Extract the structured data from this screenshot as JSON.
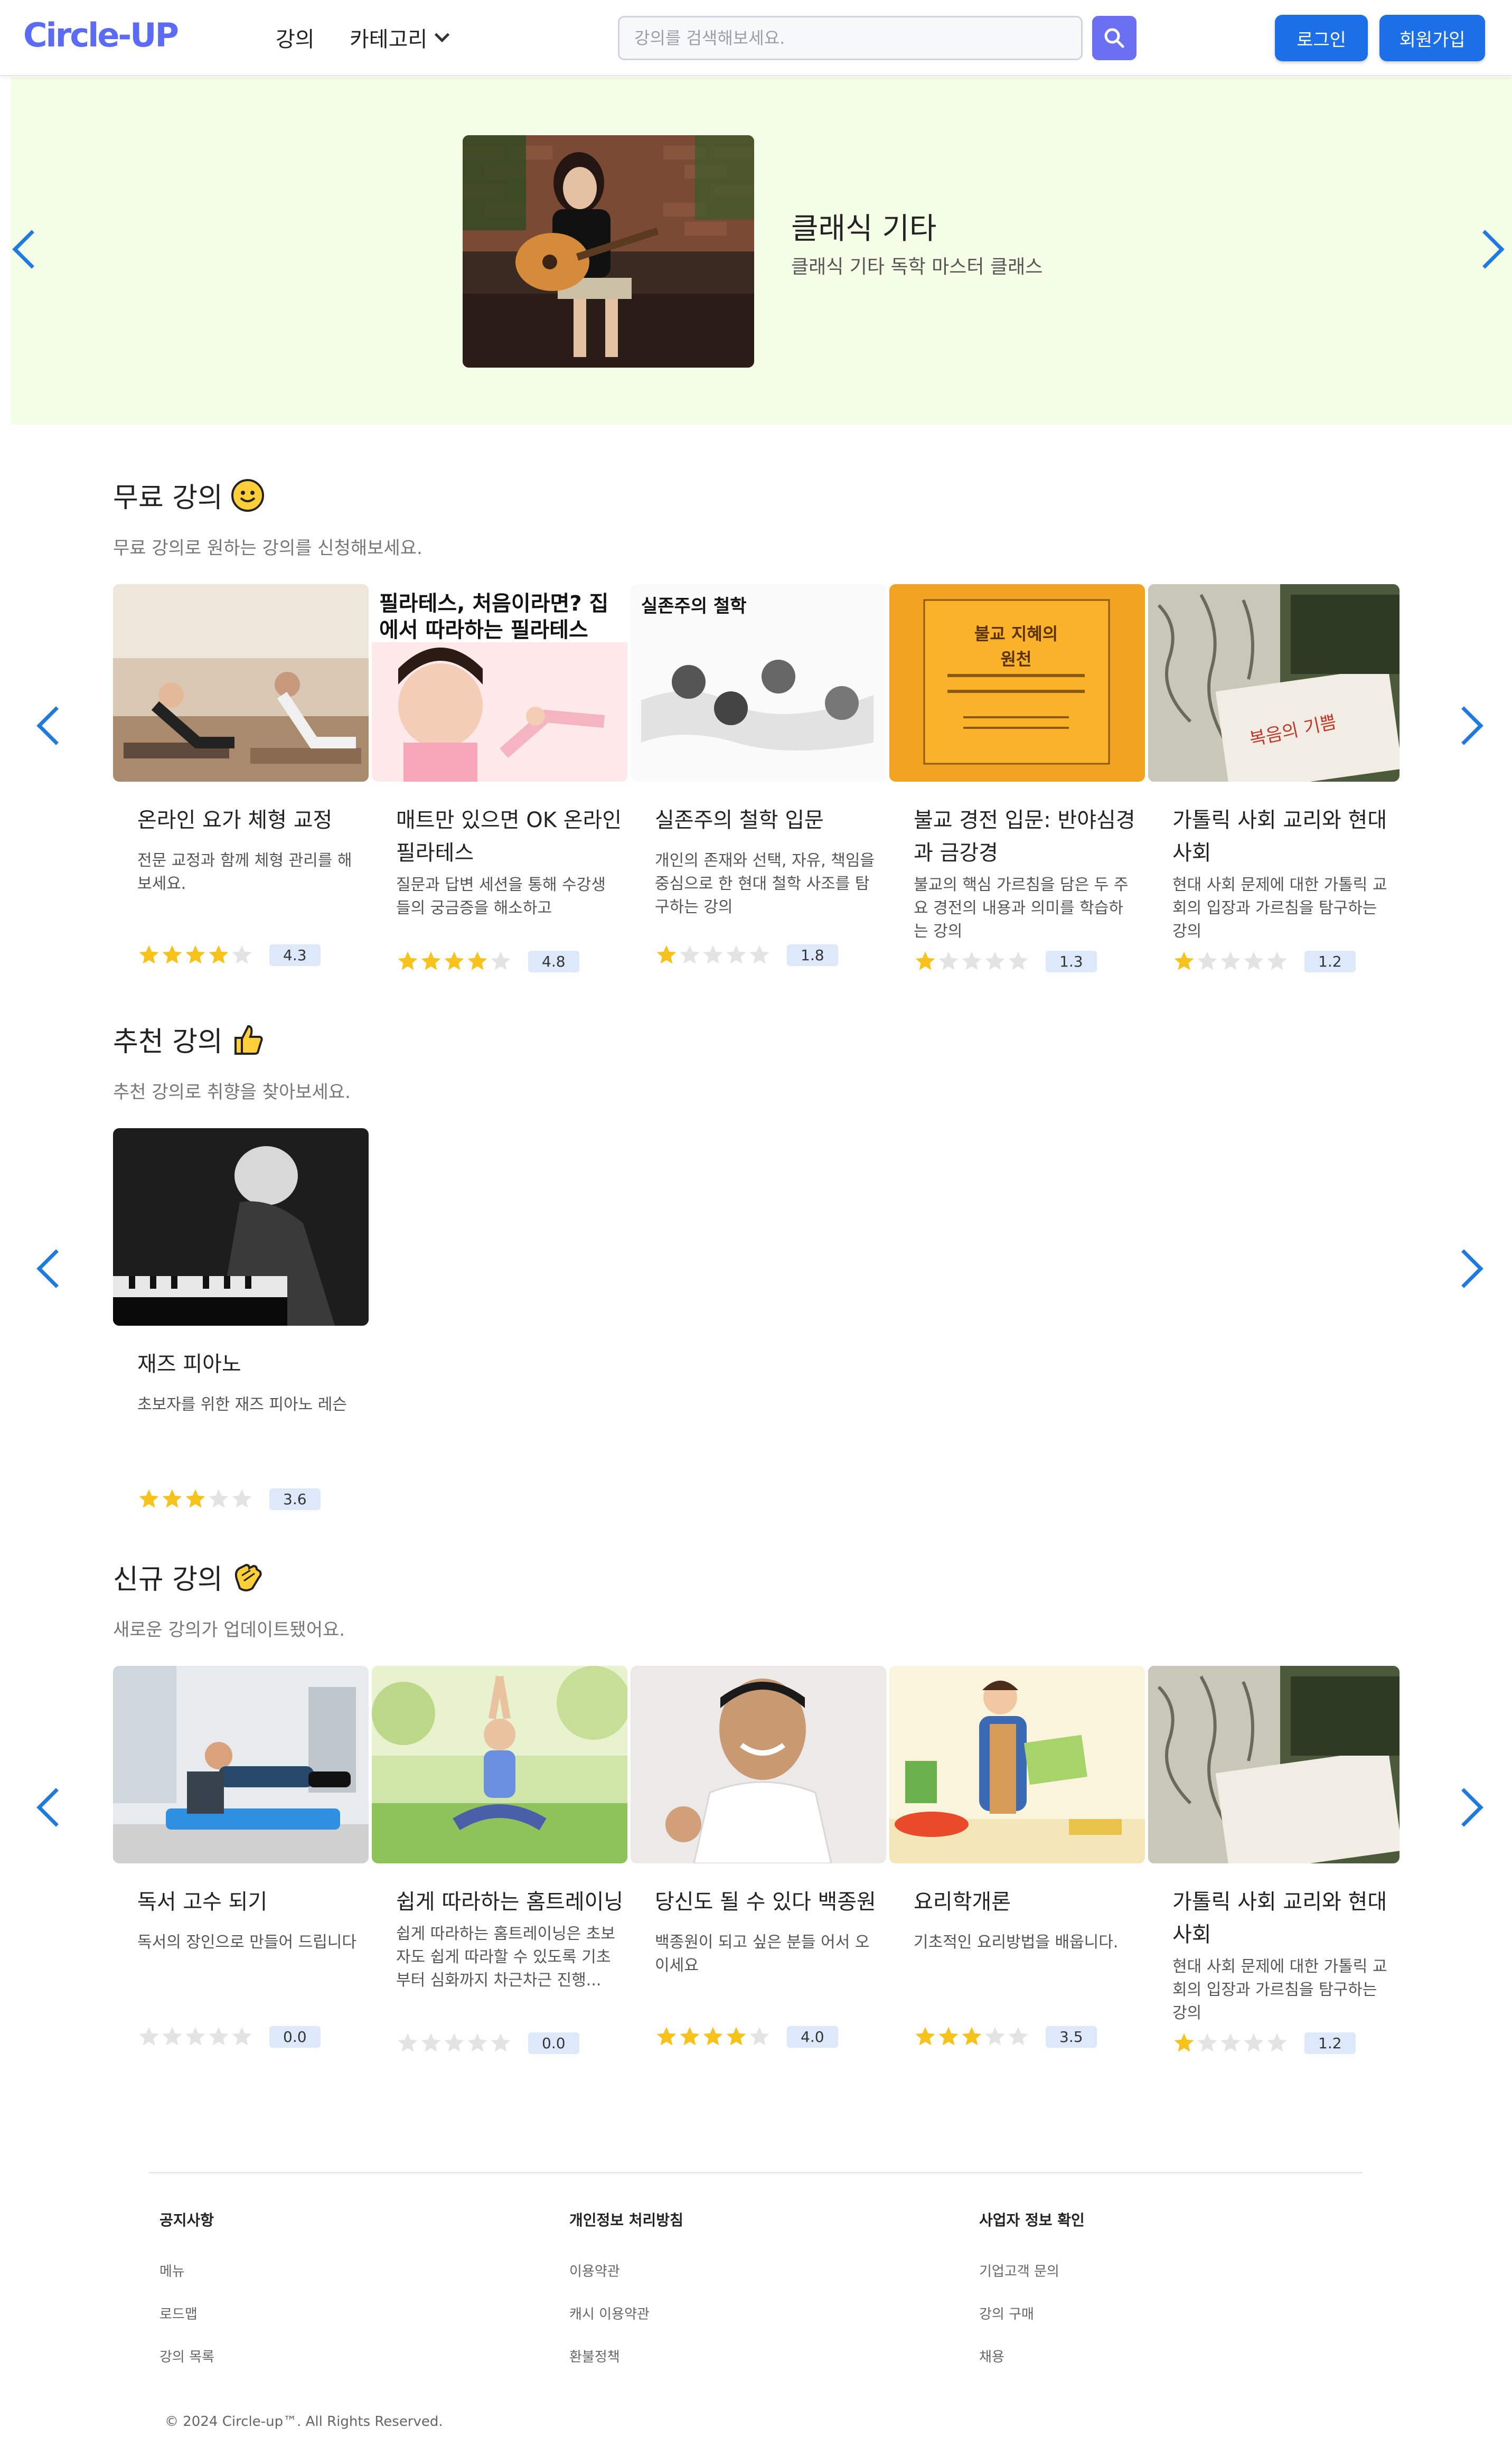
{
  "header": {
    "logo": "Circle-UP",
    "nav_lectures": "강의",
    "nav_category": "카테고리",
    "search_placeholder": "강의를 검색해보세요.",
    "login": "로그인",
    "signup": "회원가입"
  },
  "hero": {
    "title": "클래식 기타",
    "subtitle": "클래식 기타 독학 마스터 클래스"
  },
  "free": {
    "title": "무료 강의",
    "subtitle": "무료 강의로 원하는 강의를 신청해보세요.",
    "cards": [
      {
        "title": "온라인 요가 체형 교정",
        "desc": "전문 교정과 함께 체형 관리를 해보세요.",
        "rating": 4.3,
        "rating_text": "4.3"
      },
      {
        "title": "매트만 있으면 OK 온라인 필라테스",
        "desc": "질문과 답변 세션을 통해 수강생들의 궁금증을 해소하고",
        "rating": 4.8,
        "rating_text": "4.8",
        "thumb_text": "필라테스, 처음이라면? 집에서 따라하는 필라테스"
      },
      {
        "title": "실존주의 철학 입문",
        "desc": "개인의 존재와 선택, 자유, 책임을 중심으로 한 현대 철학 사조를 탐구하는 강의",
        "rating": 1.8,
        "rating_text": "1.8",
        "thumb_text": "실존주의 철학"
      },
      {
        "title": "불교 경전 입문: 반야심경과 금강경",
        "desc": "불교의 핵심 가르침을 담은 두 주요 경전의 내용과 의미를 학습하는 강의",
        "rating": 1.3,
        "rating_text": "1.3",
        "thumb_text": "불교 지혜의 원천"
      },
      {
        "title": "가톨릭 사회 교리와 현대 사회",
        "desc": "현대 사회 문제에 대한 가톨릭 교회의 입장과 가르침을 탐구하는 강의",
        "rating": 1.2,
        "rating_text": "1.2",
        "thumb_text": "복음의 기쁨"
      }
    ]
  },
  "recommended": {
    "title": "추천 강의",
    "subtitle": "추천 강의로 취향을 찾아보세요.",
    "cards": [
      {
        "title": "재즈 피아노",
        "desc": "초보자를 위한 재즈 피아노 레슨",
        "rating": 3.6,
        "rating_text": "3.6"
      }
    ]
  },
  "new": {
    "title": "신규 강의",
    "subtitle": "새로운 강의가 업데이트됐어요.",
    "cards": [
      {
        "title": "독서 고수 되기",
        "desc": "독서의 장인으로 만들어 드립니다",
        "rating": 0.0,
        "rating_text": "0.0"
      },
      {
        "title": "쉽게 따라하는 홈트레이닝",
        "desc": "쉽게 따라하는 홈트레이닝은 초보자도 쉽게 따라할 수 있도록 기초부터 심화까지 차근차근 진행...",
        "rating": 0.0,
        "rating_text": "0.0"
      },
      {
        "title": "당신도 될 수 있다 백종원",
        "desc": "백종원이 되고 싶은 분들 어서 오이세요",
        "rating": 4.0,
        "rating_text": "4.0"
      },
      {
        "title": "요리학개론",
        "desc": "기초적인 요리방법을 배웁니다.",
        "rating": 3.5,
        "rating_text": "3.5"
      },
      {
        "title": "가톨릭 사회 교리와 현대 사회",
        "desc": "현대 사회 문제에 대한 가톨릭 교회의 입장과 가르침을 탐구하는 강의",
        "rating": 1.2,
        "rating_text": "1.2"
      }
    ]
  },
  "footer": {
    "col1": {
      "head": "공지사항",
      "items": [
        "메뉴",
        "로드맵",
        "강의 목록"
      ]
    },
    "col2": {
      "head": "개인정보 처리방침",
      "items": [
        "이용약관",
        "캐시 이용약관",
        "환불정책"
      ]
    },
    "col3": {
      "head": "사업자 정보 확인",
      "items": [
        "기업고객 문의",
        "강의 구매",
        "채용"
      ]
    },
    "copyright": "© 2024 Circle-up™. All Rights Reserved."
  },
  "colors": {
    "brand": "#5b6bf5",
    "primary_button": "#1d6fe8",
    "hero_bg": "#f4fde6",
    "star": "#f7c21c",
    "badge": "#dde9fb"
  },
  "icons": [
    "chevron-down-icon",
    "search-icon",
    "arrow-left-icon",
    "arrow-right-icon",
    "star-icon",
    "smile-emoji-icon",
    "thumbs-up-emoji-icon",
    "clap-emoji-icon"
  ]
}
